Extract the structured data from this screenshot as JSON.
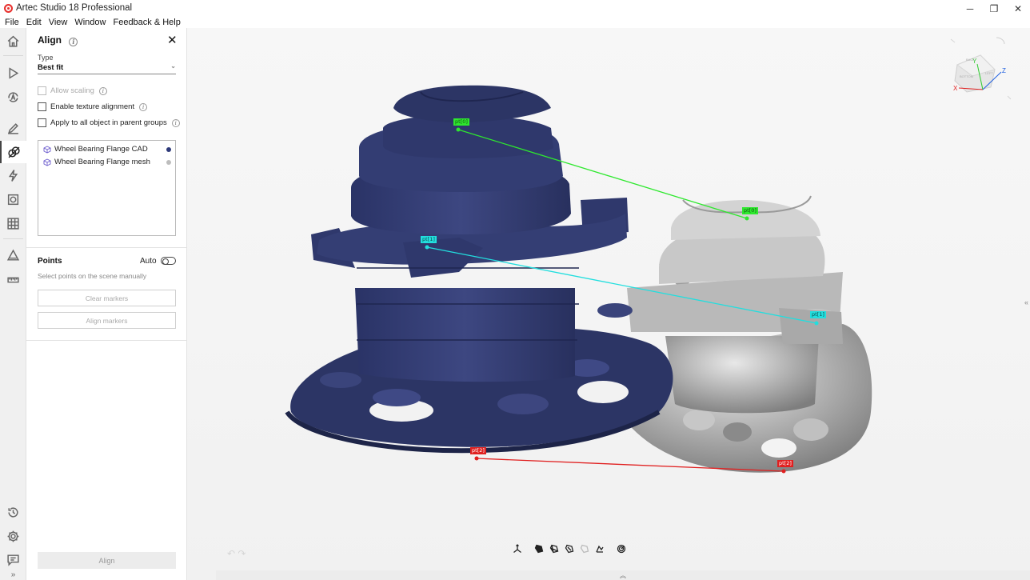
{
  "window": {
    "title": "Artec Studio 18 Professional",
    "controls": {
      "minimize": "─",
      "restore": "❐",
      "close": "✕"
    }
  },
  "menu": [
    "File",
    "Edit",
    "View",
    "Window",
    "Feedback & Help"
  ],
  "sidebar_icons": [
    "home-icon",
    "play-icon",
    "autopilot-icon",
    "edit-pencil-icon",
    "align-icon",
    "lightning-icon",
    "texture-icon",
    "checker-icon",
    "measure-triangle-icon",
    "ruler-icon",
    "history-icon",
    "settings-gear-icon",
    "chat-icon",
    "expand-chevron-icon"
  ],
  "panel": {
    "title": "Align",
    "type_label": "Type",
    "type_value": "Best fit",
    "options": [
      {
        "label": "Allow scaling",
        "checked": false,
        "disabled": true
      },
      {
        "label": "Enable texture alignment",
        "checked": false,
        "disabled": false
      },
      {
        "label": "Apply to all object in parent groups",
        "checked": false,
        "disabled": false
      }
    ],
    "objects": [
      {
        "name": "Wheel Bearing Flange CAD",
        "dot_color": "#2e3a7a"
      },
      {
        "name": "Wheel Bearing Flange mesh",
        "dot_color": "#bdbdbd"
      }
    ],
    "points": {
      "title": "Points",
      "auto_label": "Auto",
      "auto_on": false,
      "hint": "Select points on the scene manually",
      "clear_label": "Clear markers",
      "align_markers_label": "Align markers"
    },
    "align_label": "Align"
  },
  "viewport": {
    "markers": [
      {
        "label": "pt[0]",
        "color": "#2ee82e"
      },
      {
        "label": "pt[0]",
        "color": "#2ee82e"
      },
      {
        "label": "pt[1]",
        "color": "#22dede"
      },
      {
        "label": "pt[1]",
        "color": "#22dede"
      },
      {
        "label": "pt[2]",
        "color": "#e02020"
      },
      {
        "label": "pt[2]",
        "color": "#e02020"
      }
    ],
    "gizmo": {
      "x_label": "X",
      "y_label": "Y",
      "z_label": "Z",
      "cube_faces": [
        "BACK",
        "BOTTOM",
        "LEFT"
      ]
    },
    "bottom_tools": [
      "transform-axes-icon",
      "view-solid-icon",
      "view-wire-icon",
      "view-textured-icon",
      "view-ghost-icon",
      "lighting-icon",
      "spiral-icon"
    ]
  }
}
